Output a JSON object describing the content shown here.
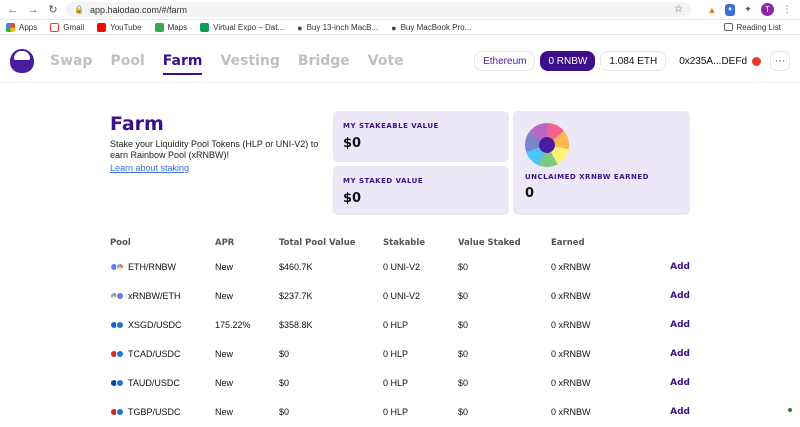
{
  "browser": {
    "url": "app.halodao.com/#/farm",
    "bookmarks": [
      "Apps",
      "Gmail",
      "YouTube",
      "Maps",
      "Virtual Expo – Dat...",
      "Buy 13-inch MacB...",
      "Buy MacBook Pro..."
    ],
    "reading_list": "Reading List",
    "avatar_letter": "T"
  },
  "nav": {
    "items": [
      "Swap",
      "Pool",
      "Farm",
      "Vesting",
      "Bridge",
      "Vote"
    ],
    "active": "Farm"
  },
  "header": {
    "network": "Ethereum",
    "rnbw_balance": "0 RNBW",
    "eth_balance": "1.084 ETH",
    "address": "0x235A...DEFd"
  },
  "farm": {
    "title": "Farm",
    "description": "Stake your Liquidity Pool Tokens (HLP or UNI-V2) to earn Rainbow Pool (xRNBW)!",
    "link": "Learn about staking"
  },
  "cards": {
    "stakeable": {
      "label": "MY STAKEABLE VALUE",
      "value": "$0"
    },
    "staked": {
      "label": "MY STAKED VALUE",
      "value": "$0"
    },
    "unclaimed": {
      "label": "UNCLAIMED XRNBW EARNED",
      "value": "0"
    }
  },
  "table": {
    "headers": [
      "Pool",
      "APR",
      "Total Pool Value",
      "Stakable",
      "Value Staked",
      "Earned"
    ],
    "rows": [
      {
        "pool": "ETH/RNBW",
        "apr": "New",
        "tpv": "$460.7K",
        "stakable": "0 UNI-V2",
        "staked": "$0",
        "earned": "0 xRNBW",
        "action": "Add"
      },
      {
        "pool": "xRNBW/ETH",
        "apr": "New",
        "tpv": "$237.7K",
        "stakable": "0 UNI-V2",
        "staked": "$0",
        "earned": "0 xRNBW",
        "action": "Add"
      },
      {
        "pool": "XSGD/USDC",
        "apr": "175.22%",
        "tpv": "$358.8K",
        "stakable": "0 HLP",
        "staked": "$0",
        "earned": "0 xRNBW",
        "action": "Add"
      },
      {
        "pool": "TCAD/USDC",
        "apr": "New",
        "tpv": "$0",
        "stakable": "0 HLP",
        "staked": "$0",
        "earned": "0 xRNBW",
        "action": "Add"
      },
      {
        "pool": "TAUD/USDC",
        "apr": "New",
        "tpv": "$0",
        "stakable": "0 HLP",
        "staked": "$0",
        "earned": "0 xRNBW",
        "action": "Add"
      },
      {
        "pool": "TGBP/USDC",
        "apr": "New",
        "tpv": "$0",
        "stakable": "0 HLP",
        "staked": "$0",
        "earned": "0 xRNBW",
        "action": "Add"
      }
    ]
  }
}
